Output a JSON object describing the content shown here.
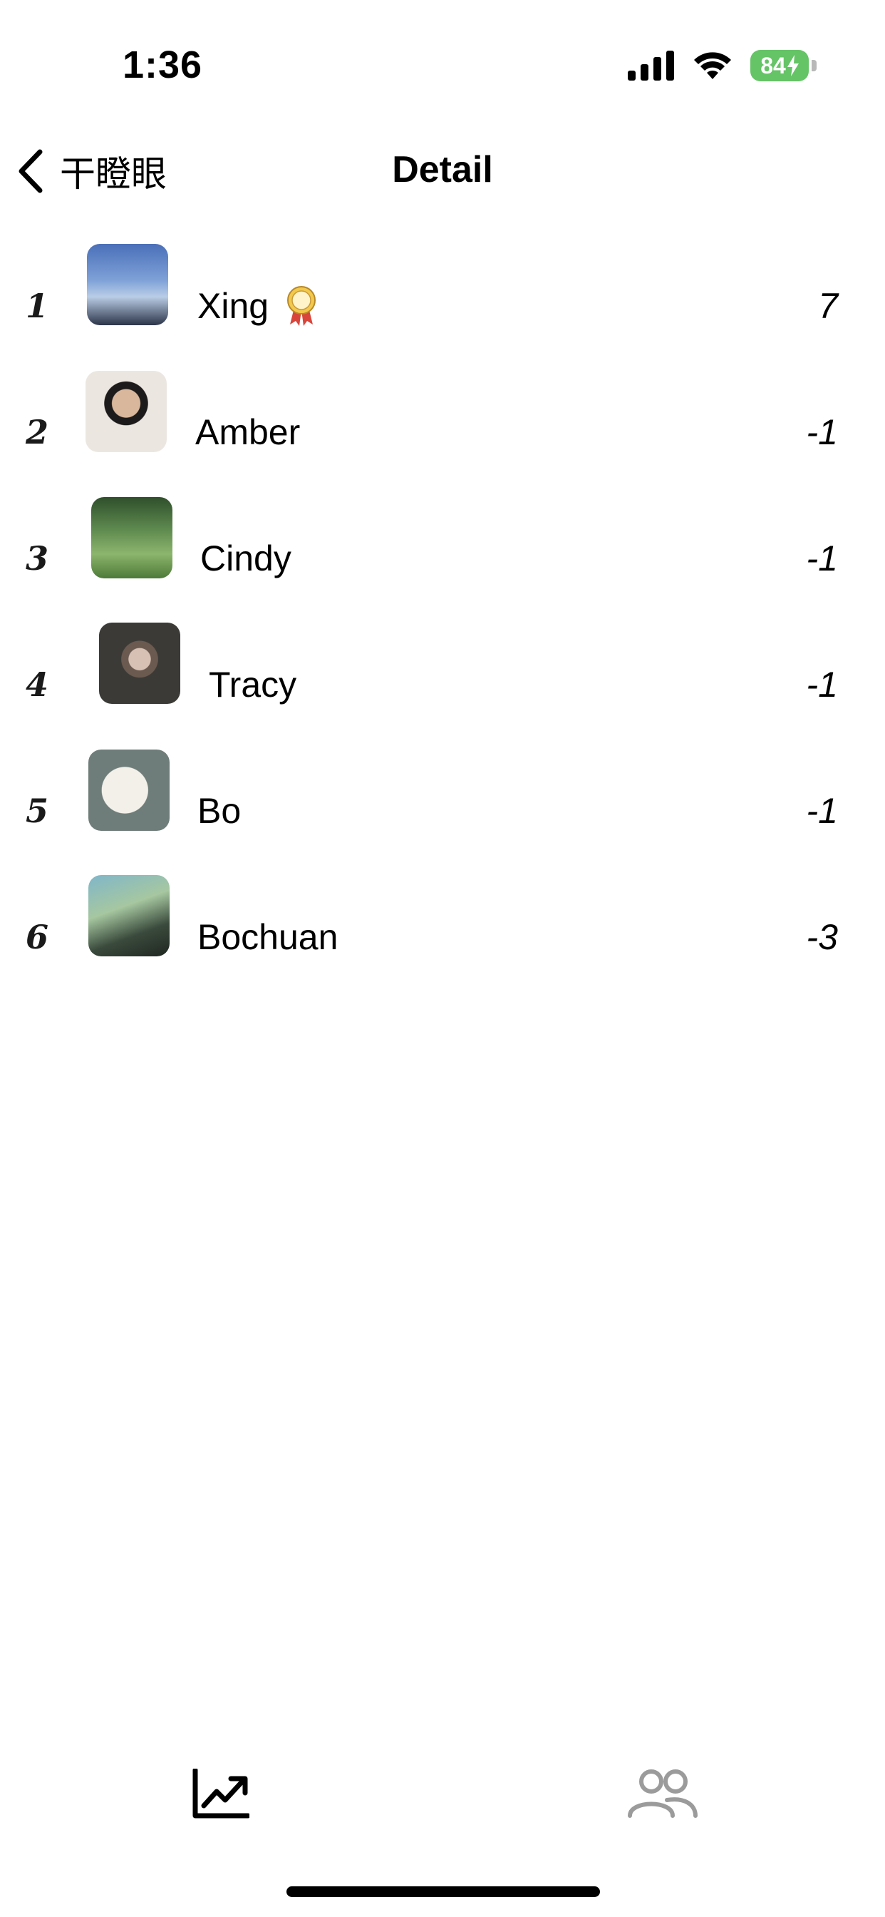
{
  "status_bar": {
    "time": "1:36",
    "battery_level": "84",
    "icons": [
      "cellular-signal-icon",
      "wifi-icon",
      "battery-charging-icon"
    ]
  },
  "nav": {
    "back_label": "干瞪眼",
    "title": "Detail"
  },
  "leaderboard": [
    {
      "rank": "1",
      "name": "Xing",
      "score": "7",
      "badge": "medal-icon"
    },
    {
      "rank": "2",
      "name": "Amber",
      "score": "-1"
    },
    {
      "rank": "3",
      "name": "Cindy",
      "score": "-1"
    },
    {
      "rank": "4",
      "name": "Tracy",
      "score": "-1"
    },
    {
      "rank": "5",
      "name": "Bo",
      "score": "-1"
    },
    {
      "rank": "6",
      "name": "Bochuan",
      "score": "-3"
    }
  ],
  "tab_bar": {
    "tabs": [
      {
        "icon": "trending-chart-icon",
        "active": true
      },
      {
        "icon": "people-icon",
        "active": false
      }
    ],
    "active_color": "#000000",
    "inactive_color": "#9b9b9b"
  },
  "colors": {
    "battery": "#65c466",
    "background": "#ffffff"
  }
}
